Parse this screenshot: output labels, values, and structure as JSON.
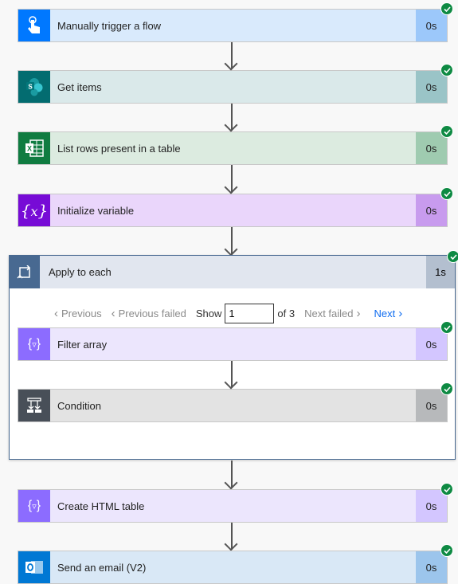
{
  "steps": [
    {
      "label": "Manually trigger a flow",
      "duration": "0s",
      "icon": "touch-icon",
      "colors": {
        "icon": "#0078ff",
        "bg": "#d9eafc",
        "dur": "#9cc8fa"
      }
    },
    {
      "label": "Get items",
      "duration": "0s",
      "icon": "sharepoint-icon",
      "colors": {
        "icon": "#036c70",
        "bg": "#dae9ea",
        "dur": "#9ac4c7"
      }
    },
    {
      "label": "List rows present in a table",
      "duration": "0s",
      "icon": "excel-icon",
      "colors": {
        "icon": "#107c41",
        "bg": "#dcebe0",
        "dur": "#9fcbb0"
      }
    },
    {
      "label": "Initialize variable",
      "duration": "0s",
      "icon": "variable-icon",
      "colors": {
        "icon": "#770bd6",
        "bg": "#ead6fb",
        "dur": "#c89bee"
      }
    }
  ],
  "apply": {
    "label": "Apply to each",
    "duration": "1s",
    "icon": "loop-icon",
    "pager": {
      "previous": "Previous",
      "previous_failed": "Previous failed",
      "show": "Show",
      "value": "1",
      "of": "of 3",
      "next_failed": "Next failed",
      "next": "Next"
    },
    "steps": [
      {
        "label": "Filter array",
        "duration": "0s",
        "icon": "filter-icon",
        "colors": {
          "icon": "#8c6cff",
          "bg": "#ece6fd",
          "dur": "#d3c6ff"
        }
      },
      {
        "label": "Condition",
        "duration": "0s",
        "icon": "condition-icon",
        "colors": {
          "icon": "#484f58",
          "bg": "#e3e3e3",
          "dur": "#b7b9bb"
        }
      }
    ]
  },
  "after": [
    {
      "label": "Create HTML table",
      "duration": "0s",
      "icon": "filter-icon",
      "colors": {
        "icon": "#8c6cff",
        "bg": "#ece6fd",
        "dur": "#d3c6ff"
      }
    },
    {
      "label": "Send an email (V2)",
      "duration": "0s",
      "icon": "outlook-icon",
      "colors": {
        "icon": "#0078d4",
        "bg": "#d9e8f6",
        "dur": "#9cc5ec"
      }
    }
  ],
  "status": "succeeded"
}
